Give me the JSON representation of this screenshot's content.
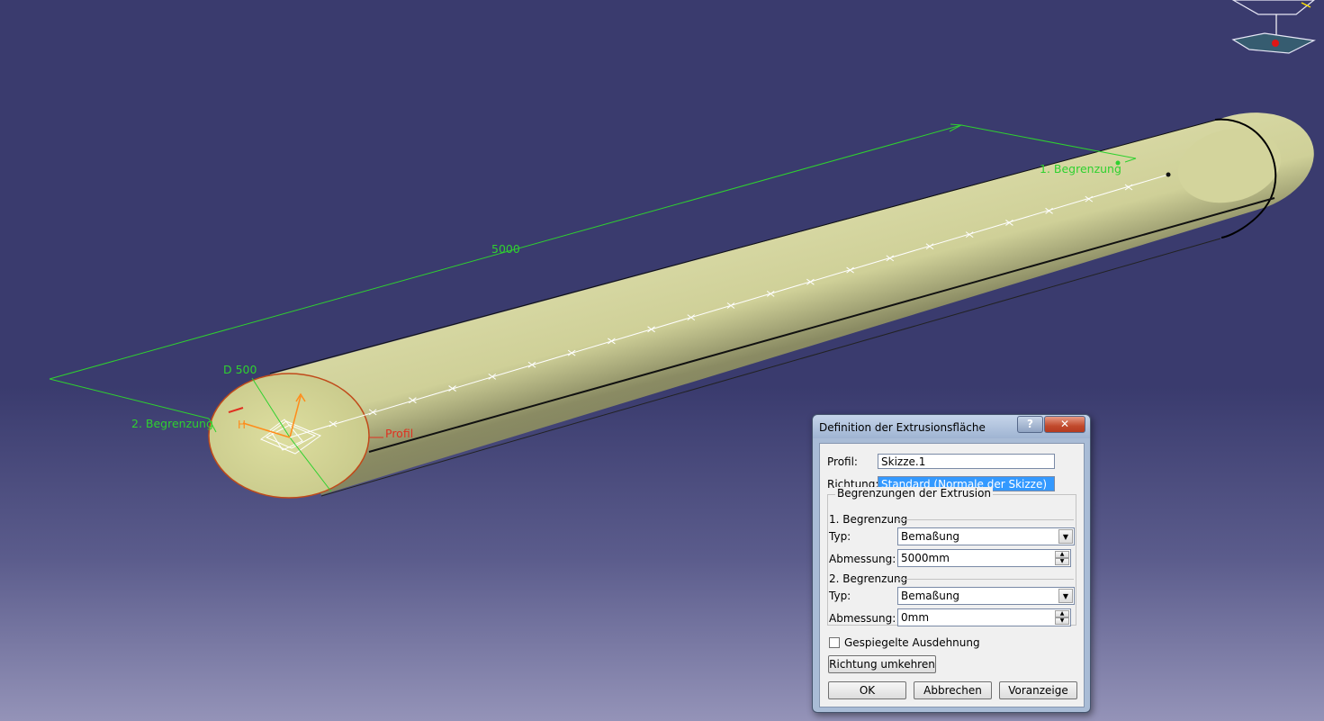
{
  "viewport": {
    "dimension_length": "5000",
    "dimension_diameter": "D 500",
    "limit1_label": "1. Begrenzung",
    "limit2_label": "2. Begrenzung",
    "profile_label": "Profil",
    "colors": {
      "background_top": "#3a3b6e",
      "cylinder": "#c9cb92",
      "dimension": "#2fd12f",
      "profile": "#e03020"
    }
  },
  "dialog": {
    "title": "Definition der Extrusionsfläche",
    "help_label": "?",
    "close_label": "✕",
    "profile_label": "Profil:",
    "profile_value": "Skizze.1",
    "direction_label": "Richtung:",
    "direction_value": "Standard (Normale der Skizze)",
    "group_title": "Begrenzungen der Extrusion",
    "limit1": {
      "title": "1. Begrenzung",
      "type_label": "Typ:",
      "type_value": "Bemaßung",
      "dim_label": "Abmessung:",
      "dim_value": "5000mm"
    },
    "limit2": {
      "title": "2. Begrenzung",
      "type_label": "Typ:",
      "type_value": "Bemaßung",
      "dim_label": "Abmessung:",
      "dim_value": "0mm"
    },
    "mirrored_label": "Gespiegelte Ausdehnung",
    "reverse_label": "Richtung umkehren",
    "ok_label": "OK",
    "cancel_label": "Abbrechen",
    "preview_label": "Voranzeige"
  }
}
